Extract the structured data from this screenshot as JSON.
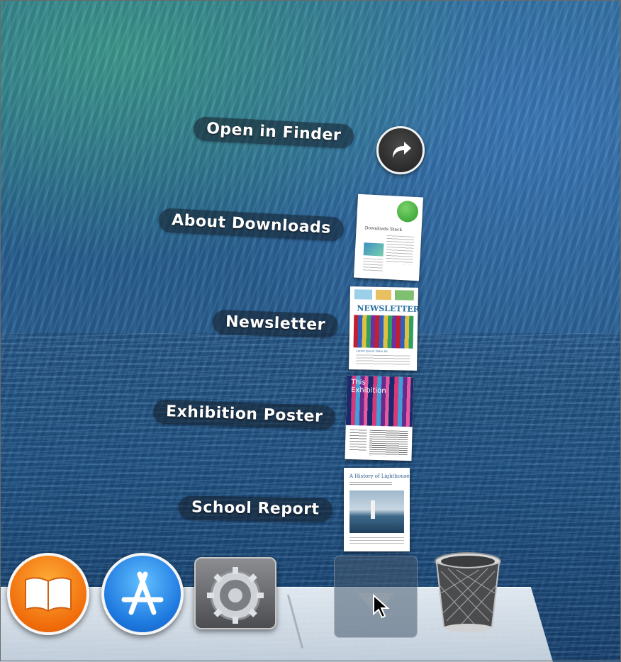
{
  "stack": {
    "open_in_finder": "Open in Finder",
    "items": [
      {
        "label": "About Downloads"
      },
      {
        "label": "Newsletter"
      },
      {
        "label": "Exhibition Poster"
      },
      {
        "label": "School Report"
      }
    ]
  },
  "docs": {
    "downloads_title": "Downloads Stack",
    "newsletter_title": "NEWSLETTER",
    "newsletter_heading": "Lorem Ipsum Dolor Sit",
    "poster_title_line1": "This",
    "poster_title_line2": "Exhibition",
    "report_title": "A History of Lighthouses"
  },
  "dock": {
    "apps": [
      {
        "name": "books-icon"
      },
      {
        "name": "app-store-icon"
      },
      {
        "name": "system-preferences-icon"
      },
      {
        "name": "downloads-stack-icon"
      },
      {
        "name": "trash-icon"
      }
    ]
  },
  "colors": {
    "label_bg": "rgba(20,30,40,0.55)",
    "books_orange": "#f06c0a",
    "appstore_blue": "#1f7ae0"
  }
}
